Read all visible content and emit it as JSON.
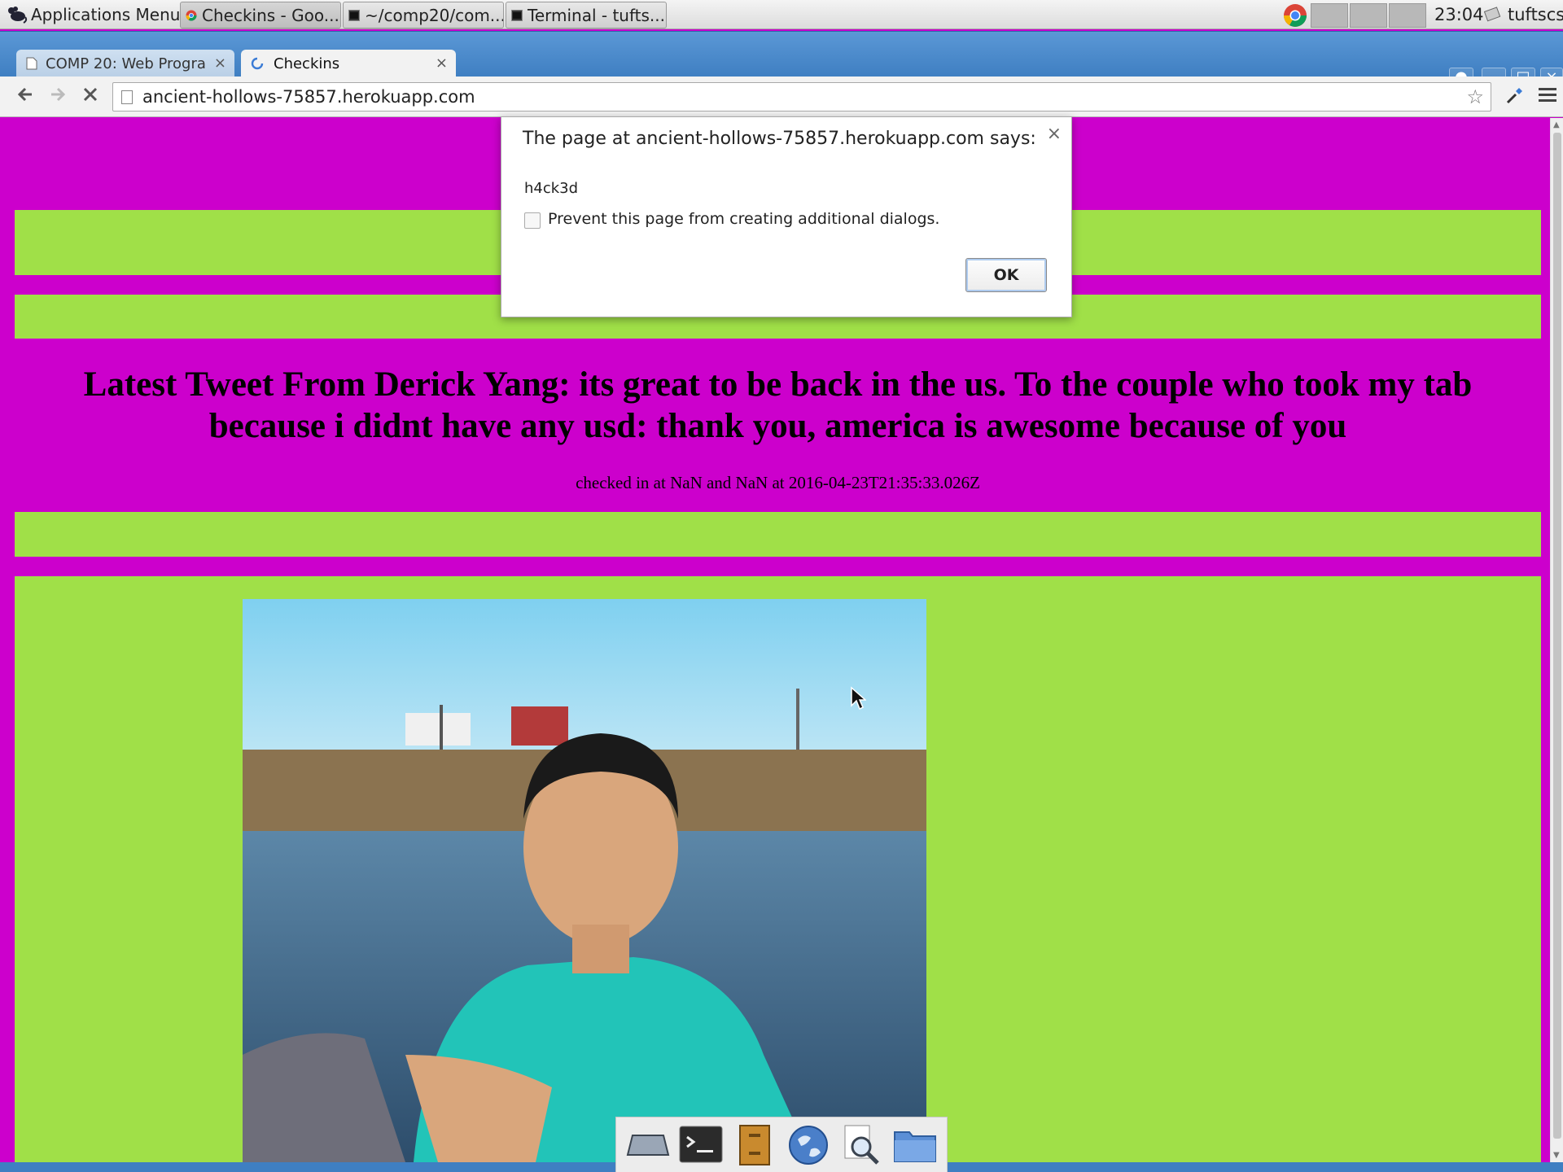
{
  "panel": {
    "apps_menu": "Applications Menu",
    "tasks": [
      {
        "label": "Checkins - Goo...",
        "icon": "chrome-icon"
      },
      {
        "label": "~/comp20/com...",
        "icon": "terminal-icon"
      },
      {
        "label": "Terminal - tufts...",
        "icon": "terminal-icon"
      }
    ],
    "clock": "23:04",
    "user": "tuftscs"
  },
  "browser": {
    "tabs": [
      {
        "title": "COMP 20: Web Progra",
        "active": false
      },
      {
        "title": "Checkins",
        "active": true
      }
    ],
    "url": "ancient-hollows-75857.herokuapp.com"
  },
  "page": {
    "tweet": "Latest Tweet From Derick Yang: its great to be back in the us. To the couple who took my tab because i didnt have any usd: thank you, america is awesome because of you",
    "checkin": "checked in at NaN and NaN at 2016-04-23T21:35:33.026Z",
    "colors": {
      "background": "#cc00cc",
      "band": "#a0e048"
    }
  },
  "dialog": {
    "title": "The page at ancient-hollows-75857.herokuapp.com says:",
    "message": "h4ck3d",
    "checkbox_label": "Prevent this page from creating additional dialogs.",
    "ok_label": "OK"
  },
  "dock": {
    "icons": [
      "desktop-icon",
      "terminal-icon",
      "file-cabinet-icon",
      "web-browser-icon",
      "search-icon",
      "folder-icon"
    ]
  }
}
